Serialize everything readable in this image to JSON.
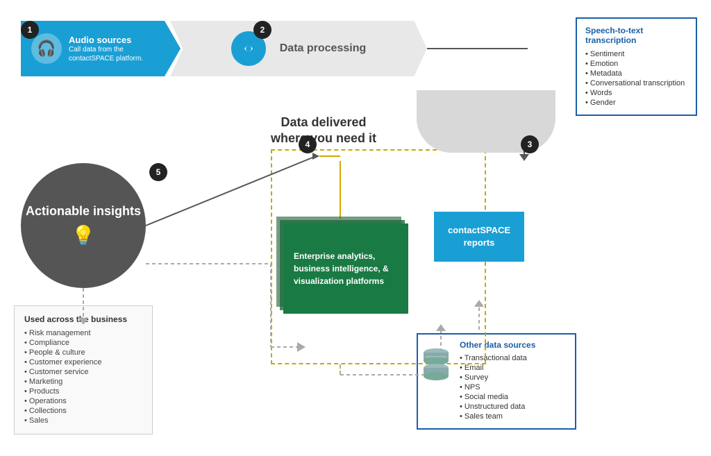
{
  "step1": {
    "badge": "1",
    "title": "Audio sources",
    "subtitle": "Call data from the contactSPACE platform."
  },
  "step2": {
    "badge": "2",
    "label": "Data processing"
  },
  "step3": {
    "badge": "3"
  },
  "step4": {
    "badge": "4",
    "title": "Data delivered",
    "subtitle": "where you need it"
  },
  "step5": {
    "badge": "5"
  },
  "speech_box": {
    "title": "Speech-to-text transcription",
    "items": [
      "Sentiment",
      "Emotion",
      "Metadata",
      "Conversational transcription",
      "Words",
      "Gender"
    ]
  },
  "insights": {
    "title": "Actionable insights"
  },
  "business": {
    "title": "Used across the business",
    "items": [
      "Risk management",
      "Compliance",
      "People & culture",
      "Customer experience",
      "Customer service",
      "Marketing",
      "Products",
      "Operations",
      "Collections",
      "Sales"
    ]
  },
  "analytics": {
    "label": "Enterprise analytics, business intelligence, & visualization platforms"
  },
  "reports": {
    "label": "contactSPACE reports"
  },
  "other_data": {
    "title": "Other data sources",
    "items": [
      "Transactional data",
      "Email",
      "Survey",
      "NPS",
      "Social media",
      "Unstructured data",
      "Sales team"
    ]
  }
}
